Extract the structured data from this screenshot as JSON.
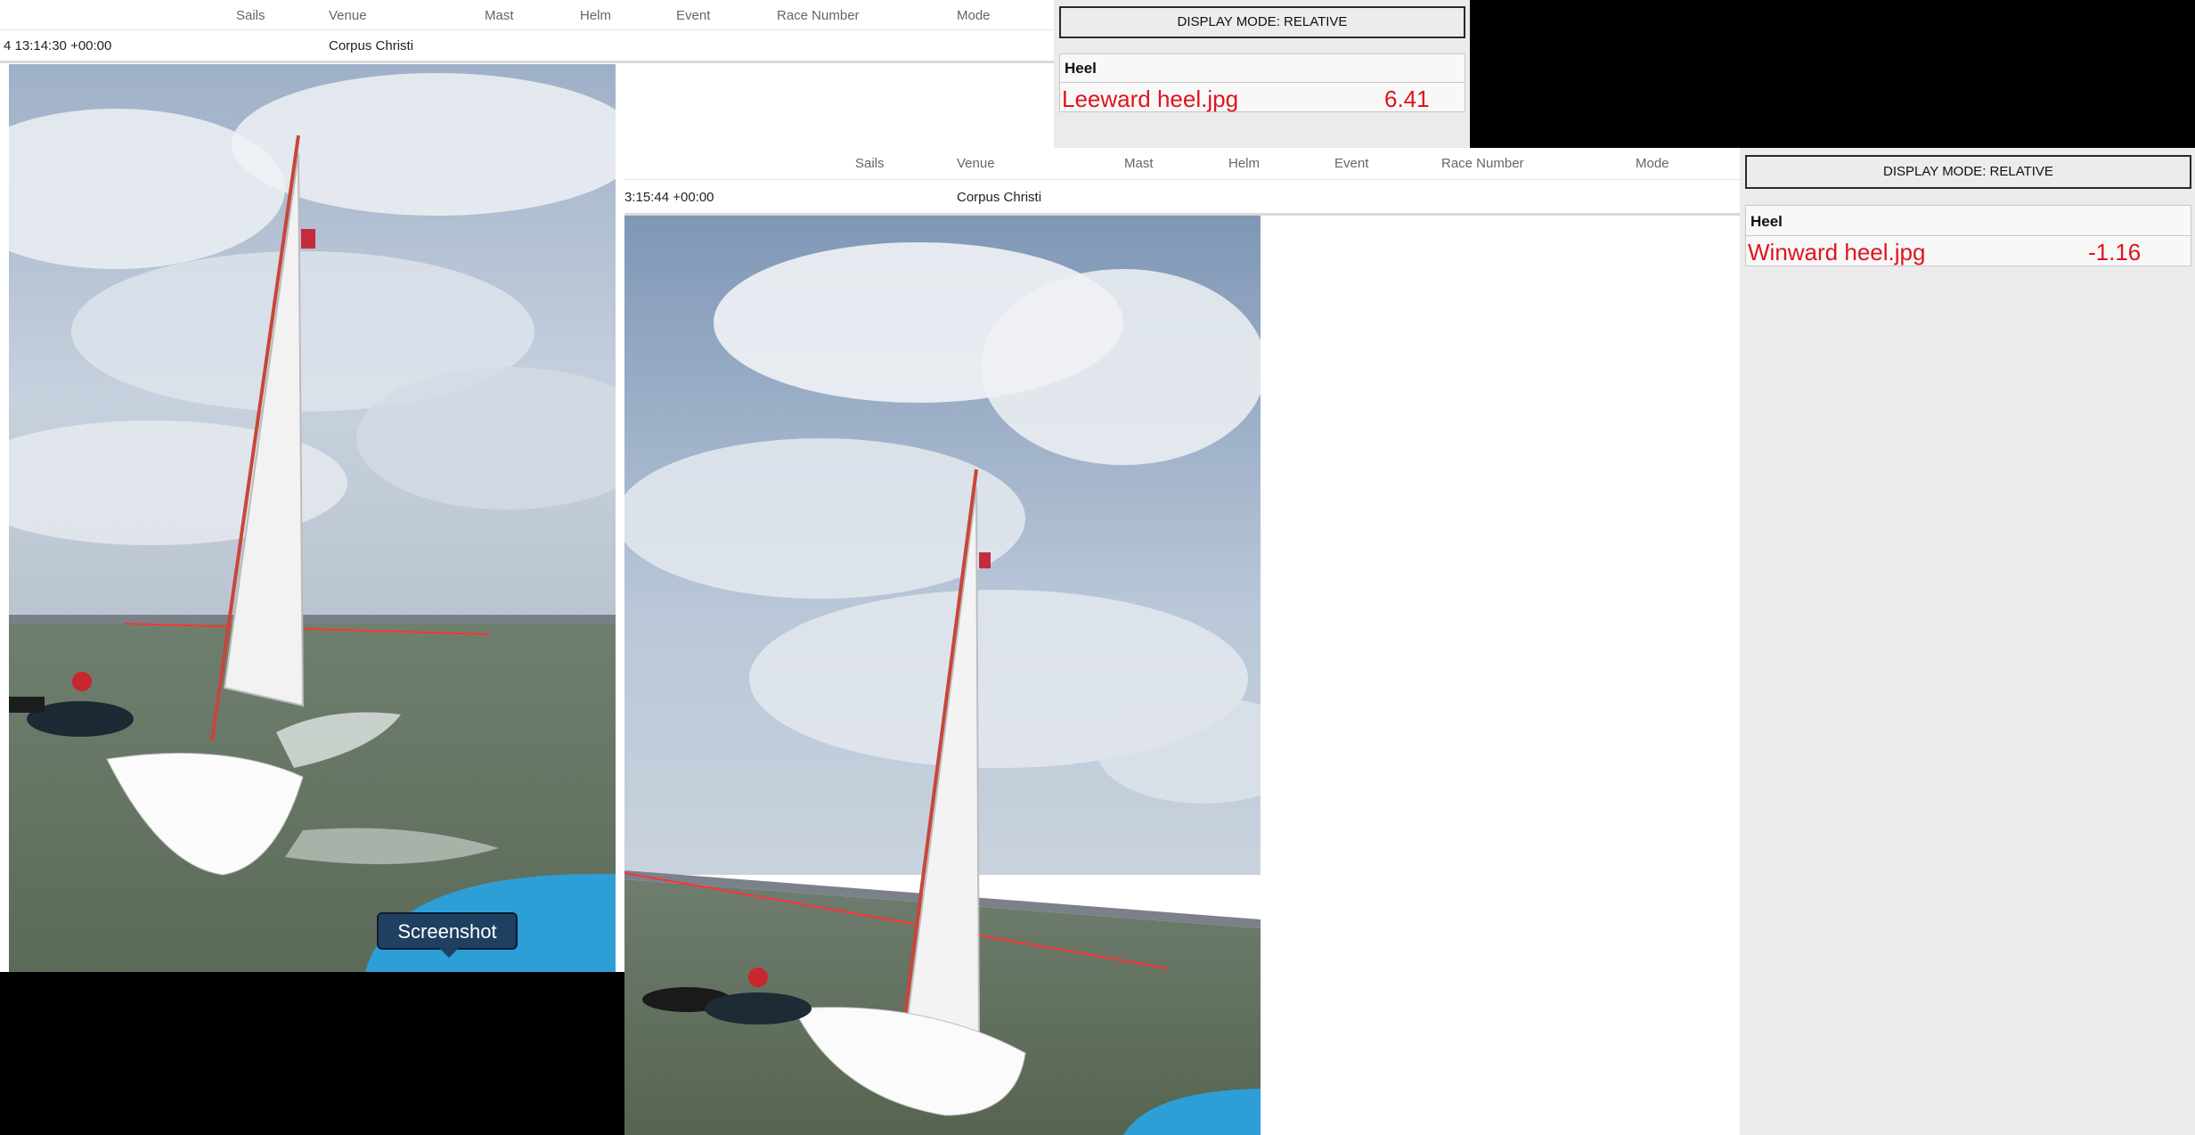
{
  "columns": [
    "Sails",
    "Venue",
    "Mast",
    "Helm",
    "Event",
    "Race Number",
    "Mode"
  ],
  "window1": {
    "timestamp": "4 13:14:30 +00:00",
    "venue": "Corpus Christi",
    "display_mode_label": "DISPLAY MODE: RELATIVE",
    "panel_title": "Heel",
    "file_name": "Leeward heel.jpg",
    "heel_value": "6.41",
    "tooltip": "Screenshot"
  },
  "window2": {
    "timestamp": "3:15:44 +00:00",
    "venue": "Corpus Christi",
    "display_mode_label": "DISPLAY MODE: RELATIVE",
    "panel_title": "Heel",
    "file_name": "Winward heel.jpg",
    "heel_value": "-1.16"
  },
  "colors": {
    "accent_red": "#e0141e",
    "tooltip_bg": "#1f4060"
  },
  "icons": {
    "tooltip_pointer": "caret-down-icon"
  }
}
